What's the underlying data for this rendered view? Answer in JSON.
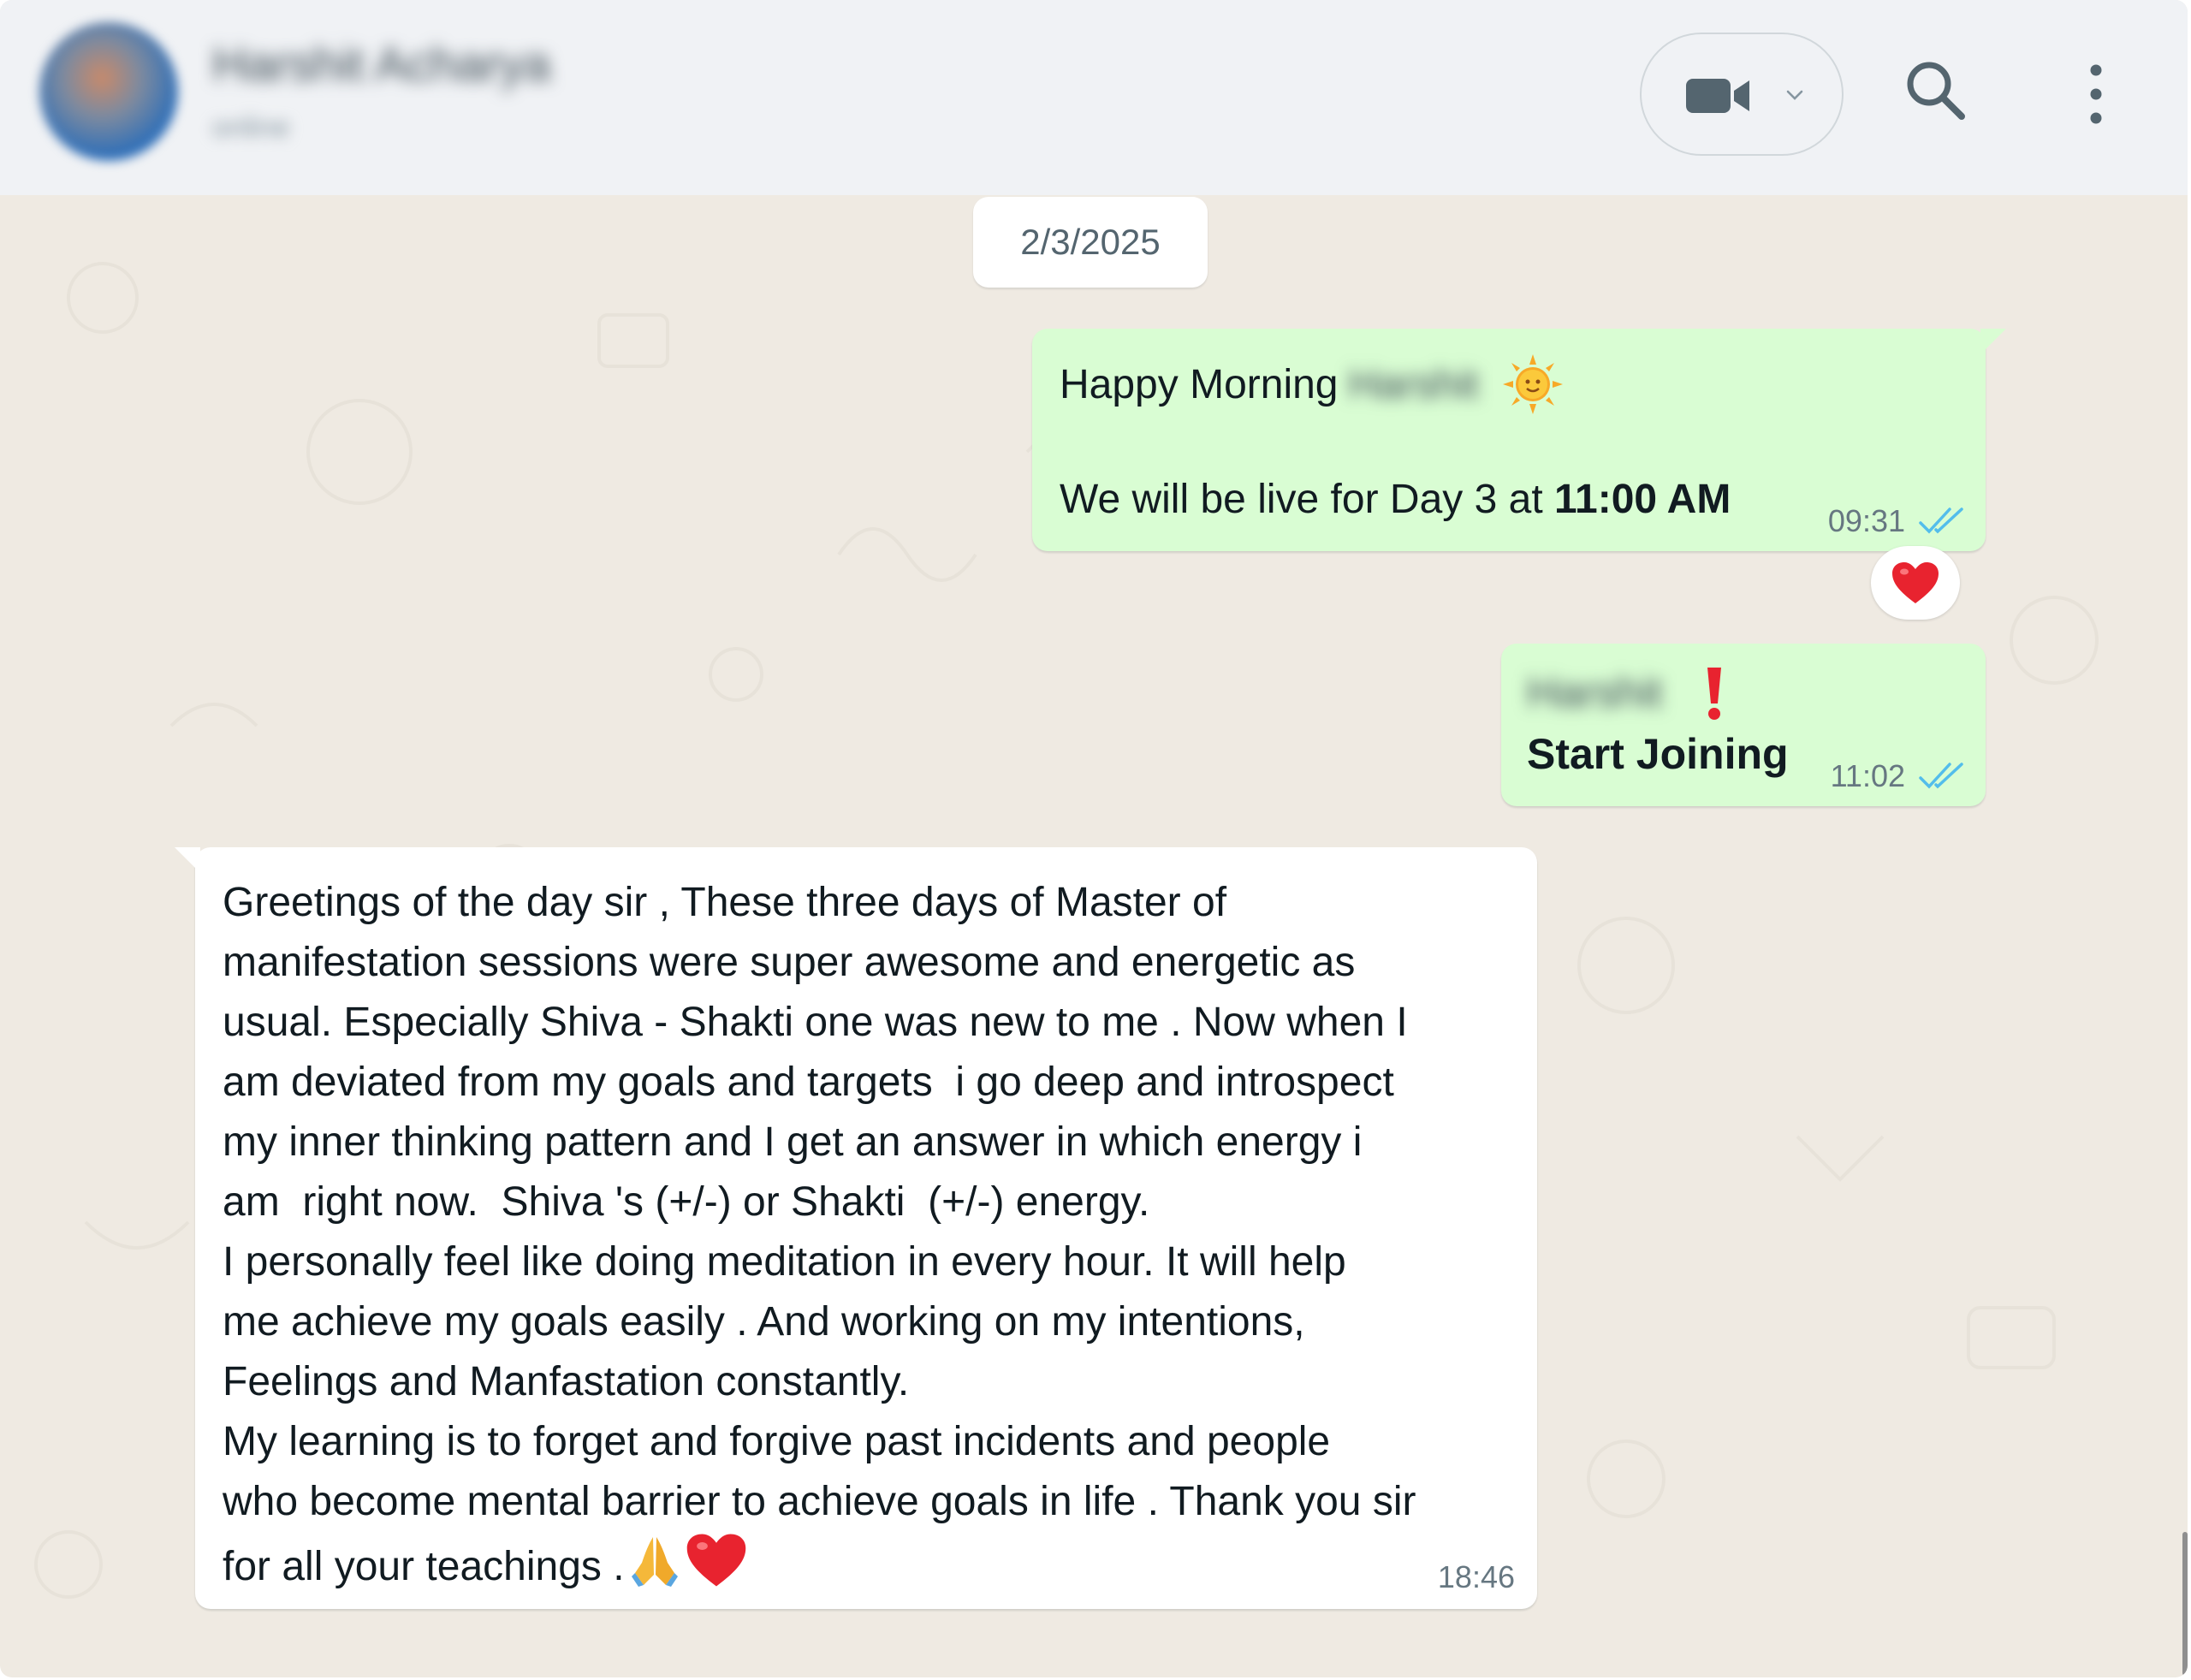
{
  "header": {
    "contact_name": "Harshit Acharya",
    "contact_status": "online",
    "video_icon": "video-camera-icon",
    "dropdown_icon": "chevron-down-icon",
    "search_icon": "search-icon",
    "menu_icon": "more-vertical-icon"
  },
  "chat": {
    "date_chip": "2/3/2025",
    "messages": [
      {
        "direction": "outgoing",
        "line1_prefix": "Happy Morning",
        "blurred_name": "Harshit",
        "emoji": "sun-with-face-icon",
        "line2_prefix": "We will be live for Day 3 at ",
        "line2_bold": "11:00 AM",
        "time": "09:31",
        "status_icon": "double-check-read-icon",
        "reaction": "red-heart-icon"
      },
      {
        "direction": "outgoing",
        "blurred_name": "Harshit",
        "emoji": "exclamation-icon",
        "line2": "Start Joining",
        "time": "11:02",
        "status_icon": "double-check-read-icon"
      },
      {
        "direction": "incoming",
        "lines": [
          "Greetings of the day sir , These three days of Master of",
          "manifestation sessions were super awesome and energetic as",
          "usual. Especially Shiva - Shakti one was new to me . Now when I",
          "am deviated from my goals and targets  i go deep and introspect",
          "my inner thinking pattern and I get an answer in which energy i",
          "am  right now.  Shiva 's (+/-) or Shakti  (+/-) energy.",
          "I personally feel like doing meditation in every hour. It will help",
          "me achieve my goals easily . And working on my intentions,",
          "Feelings and Manfastation constantly.",
          "My learning is to forget and forgive past incidents and people",
          "who become mental barrier to achieve goals in life . Thank you sir",
          "for all your teachings ."
        ],
        "end_emojis": [
          "folded-hands-icon",
          "red-heart-icon"
        ],
        "time": "18:46"
      }
    ]
  },
  "colors": {
    "outgoing_bubble": "#d9fdd3",
    "incoming_bubble": "#ffffff",
    "chat_background": "#efeae2",
    "header_background": "#f0f2f5",
    "read_ticks": "#53bdeb"
  }
}
